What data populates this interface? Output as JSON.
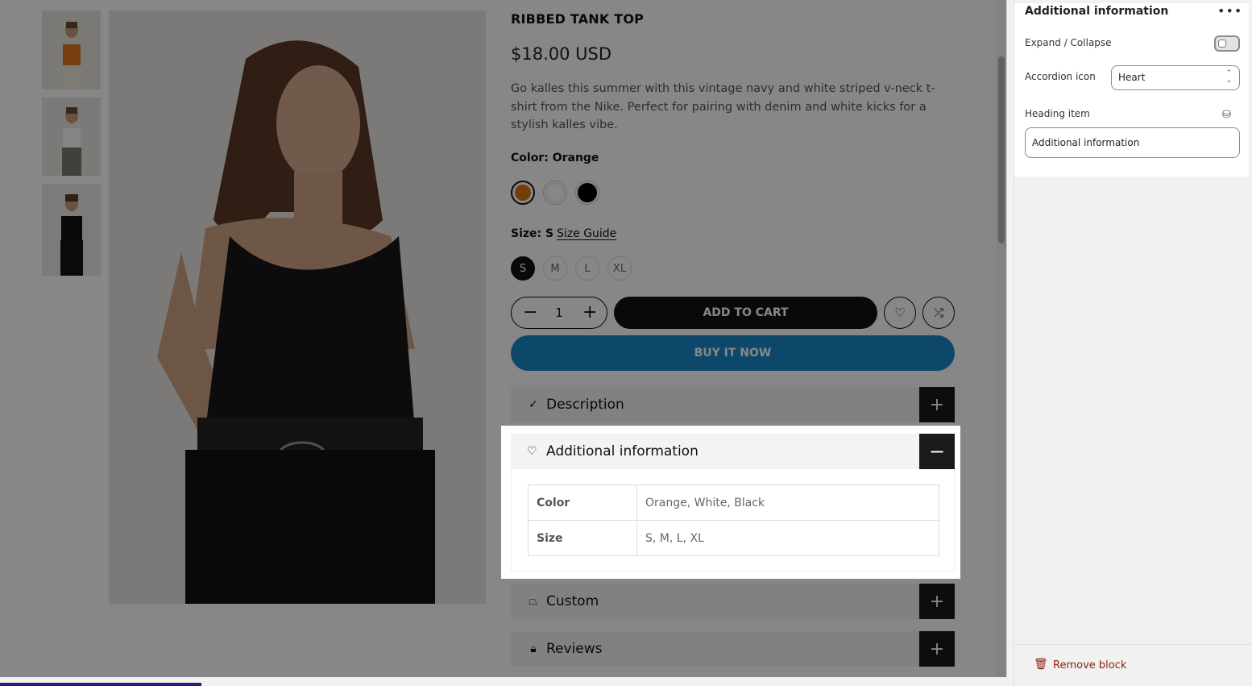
{
  "product": {
    "title": "RIBBED TANK TOP",
    "price": "$18.00 USD",
    "description": "Go kalles this summer with this vintage navy and white striped v-neck t-shirt from the Nike. Perfect for pairing with denim and white kicks for a stylish kalles vibe.",
    "color_label": "Color:",
    "color_value": "Orange",
    "swatches": [
      "#d9770f",
      "#ffffff",
      "#000000"
    ],
    "size_label": "Size:",
    "size_value": "S",
    "size_guide": "Size Guide",
    "sizes": [
      "S",
      "M",
      "L",
      "XL"
    ],
    "quantity": "1",
    "add_to_cart": "ADD TO CART",
    "buy_now": "BUY IT NOW"
  },
  "accordions": {
    "description": "Description",
    "additional": "Additional information",
    "custom": "Custom",
    "reviews": "Reviews"
  },
  "info_table": [
    {
      "key": "Color",
      "value": "Orange, White, Black"
    },
    {
      "key": "Size",
      "value": "S, M, L, XL"
    }
  ],
  "panel": {
    "title": "Additional information",
    "expand_label": "Expand / Collapse",
    "icon_label": "Accordion icon",
    "icon_value": "Heart",
    "heading_label": "Heading item",
    "heading_value": "Additional information",
    "remove": "Remove block"
  },
  "colors": {
    "buy_now": "#1a88c9",
    "remove": "#8e1f0b",
    "accent_dark": "#1a1a1a"
  }
}
